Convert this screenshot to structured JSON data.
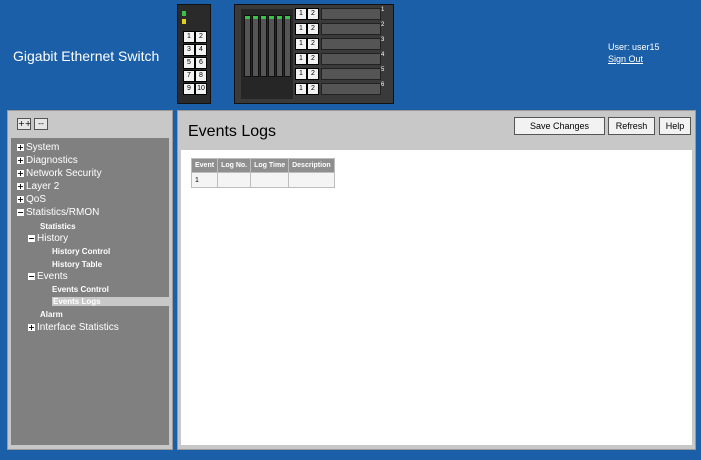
{
  "header": {
    "app_title": "Gigabit Ethernet Switch",
    "user_label": "User: user15",
    "sign_out": "Sign Out"
  },
  "device_small": {
    "ports": [
      "1",
      "2",
      "3",
      "4",
      "5",
      "6",
      "7",
      "8",
      "9",
      "10"
    ]
  },
  "device_big": {
    "rows": [
      {
        "p1": "1",
        "p2": "2",
        "num": "1"
      },
      {
        "p1": "1",
        "p2": "2",
        "num": "2"
      },
      {
        "p1": "1",
        "p2": "2",
        "num": "3"
      },
      {
        "p1": "1",
        "p2": "2",
        "num": "4"
      },
      {
        "p1": "1",
        "p2": "2",
        "num": "5"
      },
      {
        "p1": "1",
        "p2": "2",
        "num": "6"
      }
    ]
  },
  "sidebar": {
    "expand_all": "++",
    "collapse_all": "--",
    "tree": {
      "system": "System",
      "diagnostics": "Diagnostics",
      "network_security": "Network Security",
      "layer2": "Layer 2",
      "qos": "QoS",
      "statistics_rmon": "Statistics/RMON",
      "statistics": "Statistics",
      "history": "History",
      "history_control": "History Control",
      "history_table": "History Table",
      "events": "Events",
      "events_control": "Events Control",
      "events_logs": "Events Logs",
      "alarm": "Alarm",
      "interface_statistics": "Interface Statistics"
    }
  },
  "main": {
    "title": "Events Logs",
    "buttons": {
      "save": "Save Changes",
      "refresh": "Refresh",
      "help": "Help"
    },
    "table": {
      "headers": [
        "Event",
        "Log No.",
        "Log Time",
        "Description"
      ],
      "rows": [
        [
          "1",
          "",
          "",
          ""
        ]
      ]
    }
  },
  "colors": {
    "background": "#1b5fa8",
    "panel": "#c8c8c8",
    "tree": "#808080",
    "table_header": "#8f8f8f"
  }
}
